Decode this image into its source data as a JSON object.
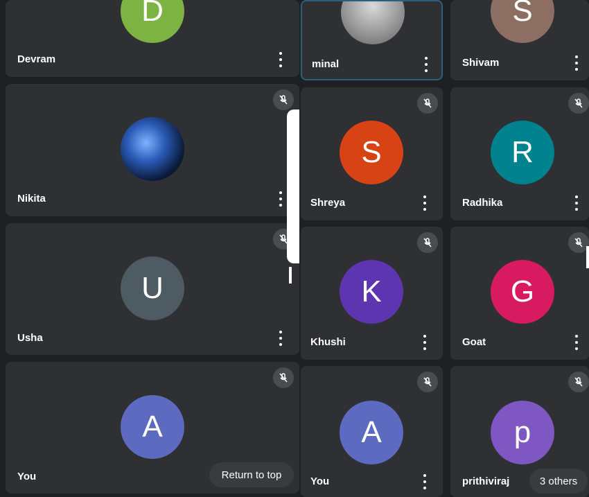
{
  "participants": [
    {
      "name": "Devram",
      "initial": "D",
      "color": "#7cb342"
    },
    {
      "name": "Nikita",
      "initial": "",
      "color": "#1b3f7a"
    },
    {
      "name": "Usha",
      "initial": "U",
      "color": "#4f5b62"
    },
    {
      "name": "You",
      "initial": "A",
      "color": "#5c6bc0"
    },
    {
      "name": "minal",
      "initial": "",
      "color": "#9e9e9e"
    },
    {
      "name": "Shivam",
      "initial": "S",
      "color": "#8d6e63"
    },
    {
      "name": "Shreya",
      "initial": "S",
      "color": "#d84315"
    },
    {
      "name": "Radhika",
      "initial": "R",
      "color": "#00838f"
    },
    {
      "name": "Khushi",
      "initial": "K",
      "color": "#5e35b1"
    },
    {
      "name": "Goat",
      "initial": "G",
      "color": "#d81b60"
    },
    {
      "name": "You",
      "initial": "A",
      "color": "#5c6bc0"
    },
    {
      "name": "prithiviraj",
      "initial": "p",
      "color": "#7e57c2"
    }
  ],
  "controls": {
    "return_to_top": "Return to top",
    "others_count": "3 others"
  },
  "icons": {
    "muted": "mic-off-icon",
    "more": "more-vert-icon"
  }
}
